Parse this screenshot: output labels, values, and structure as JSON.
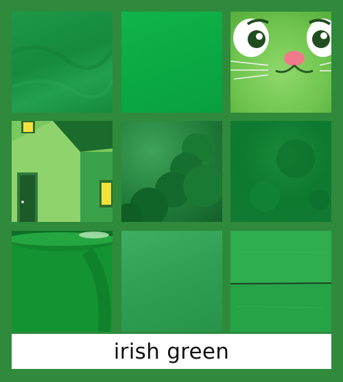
{
  "caption": "irish green",
  "colors": {
    "background": "#2f8a3c",
    "caption_background": "#ffffff",
    "caption_text": "#111111"
  },
  "tiles": [
    {
      "subject": "green-fabric-swatch"
    },
    {
      "subject": "solid-green-swatch"
    },
    {
      "subject": "cartoon-cat-face"
    },
    {
      "subject": "green-house-illustration"
    },
    {
      "subject": "green-smoke-cloud"
    },
    {
      "subject": "green-textured-wall"
    },
    {
      "subject": "green-bowl"
    },
    {
      "subject": "green-gradient-swatch"
    },
    {
      "subject": "green-wooden-planks"
    }
  ]
}
